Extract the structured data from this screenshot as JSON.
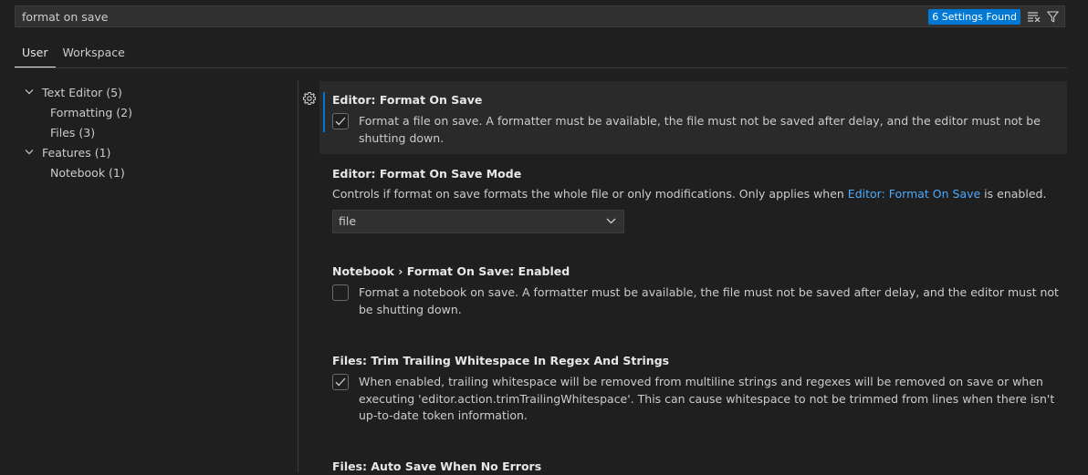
{
  "search": {
    "value": "format on save",
    "result_count": "6 Settings Found"
  },
  "tabs": [
    {
      "label": "User",
      "active": true
    },
    {
      "label": "Workspace",
      "active": false
    }
  ],
  "toc": [
    {
      "label": "Text Editor (5)",
      "level": 1
    },
    {
      "label": "Formatting (2)",
      "level": 2
    },
    {
      "label": "Files (3)",
      "level": 2
    },
    {
      "label": "Features (1)",
      "level": 1
    },
    {
      "label": "Notebook (1)",
      "level": 2
    }
  ],
  "settings": {
    "format_on_save": {
      "title": "Editor: Format On Save",
      "description": "Format a file on save. A formatter must be available, the file must not be saved after delay, and the editor must not be shutting down.",
      "checked": true
    },
    "format_on_save_mode": {
      "title": "Editor: Format On Save Mode",
      "desc_before": "Controls if format on save formats the whole file or only modifications. Only applies when ",
      "desc_link": "Editor: Format On Save",
      "desc_after": " is enabled.",
      "value": "file"
    },
    "notebook_format_on_save": {
      "title": "Notebook › Format On Save: Enabled",
      "description": "Format a notebook on save. A formatter must be available, the file must not be saved after delay, and the editor must not be shutting down.",
      "checked": false
    },
    "trim_trailing_whitespace": {
      "title": "Files: Trim Trailing Whitespace In Regex And Strings",
      "description": "When enabled, trailing whitespace will be removed from multiline strings and regexes will be removed on save or when executing 'editor.action.trimTrailingWhitespace'. This can cause whitespace to not be trimmed from lines when there isn't up-to-date token information.",
      "checked": true
    },
    "auto_save_no_errors": {
      "title": "Files: Auto Save When No Errors"
    }
  },
  "colors": {
    "accent": "#0078d4",
    "link": "#4daafc",
    "background": "#1f1f1f"
  }
}
